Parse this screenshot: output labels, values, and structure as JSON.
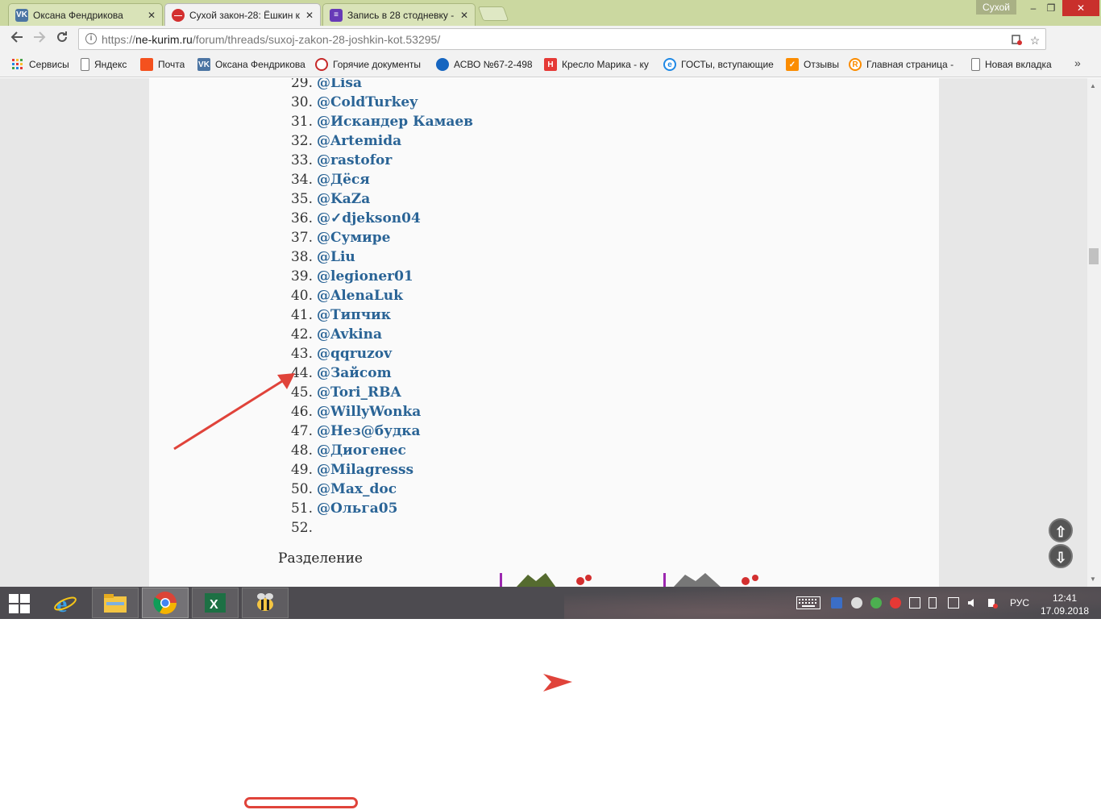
{
  "window": {
    "profile_label": "Сухой",
    "controls": {
      "minimize": "–",
      "restore": "❐",
      "close": "✕"
    }
  },
  "tabs": [
    {
      "label": "Оксана Фендрикова",
      "icon": "vk-icon",
      "icon_text": "VK",
      "icon_color": "#4c75a3",
      "close": "✕"
    },
    {
      "label": "Сухой закон-28: Ёшкин к",
      "icon": "no-entry-icon",
      "icon_text": "—",
      "icon_color": "#d32f2f",
      "close": "✕"
    },
    {
      "label": "Запись в 28 стодневку -",
      "icon": "forms-icon",
      "icon_text": "≡",
      "icon_color": "#673ab7",
      "close": "✕"
    }
  ],
  "toolbar": {
    "url_prefix": "https://",
    "url_host": "ne-kurim.ru",
    "url_path": "/forum/threads/suxoj-zakon-28-joshkin-kot.53295/",
    "extension_badge": "1"
  },
  "bookmarks": [
    {
      "label": "Сервисы",
      "icon": "apps-grid-icon",
      "color": "#e53935"
    },
    {
      "label": "Яндекс",
      "icon": "page-icon",
      "color": "#ffffff"
    },
    {
      "label": "Почта",
      "icon": "mail-icon",
      "color": "#f4511e"
    },
    {
      "label": "Оксана Фендрикова",
      "icon": "vk-icon",
      "color": "#4c75a3"
    },
    {
      "label": "Горячие документы",
      "icon": "globe-icon",
      "color": "#c62828"
    },
    {
      "label": "АСВО №67-2-498",
      "icon": "people-icon",
      "color": "#1565c0"
    },
    {
      "label": "Кресло Марика - ку",
      "icon": "h-icon",
      "color": "#e53935"
    },
    {
      "label": "ГОСТы, вступающие",
      "icon": "e-icon",
      "color": "#1e88e5"
    },
    {
      "label": "Отзывы",
      "icon": "check-icon",
      "color": "#fb8c00"
    },
    {
      "label": "Главная страница - ",
      "icon": "r-icon",
      "color": "#fb8c00"
    },
    {
      "label": "Новая вкладка",
      "icon": "page-icon",
      "color": "#ffffff"
    }
  ],
  "participants": [
    {
      "num": "29.",
      "nick": "@Lisa"
    },
    {
      "num": "30.",
      "nick": "@ColdTurkey"
    },
    {
      "num": "31.",
      "nick": "@Искандер Камаев"
    },
    {
      "num": "32.",
      "nick": "@Artemida"
    },
    {
      "num": "33.",
      "nick": "@rastofor"
    },
    {
      "num": "34.",
      "nick": "@Дёся"
    },
    {
      "num": "35.",
      "nick": "@KaZa"
    },
    {
      "num": "36.",
      "nick": "@✓djekson04"
    },
    {
      "num": "37.",
      "nick": "@Сумире"
    },
    {
      "num": "38.",
      "nick": "@Liu"
    },
    {
      "num": "39.",
      "nick": "@legioner01"
    },
    {
      "num": "40.",
      "nick": "@AlenaLuk"
    },
    {
      "num": "41.",
      "nick": "@Типчик"
    },
    {
      "num": "42.",
      "nick": "@Avkina"
    },
    {
      "num": "43.",
      "nick": "@qqruzov"
    },
    {
      "num": "44.",
      "nick": "@Зайсom"
    },
    {
      "num": "45.",
      "nick": "@Tori_RBA"
    },
    {
      "num": "46.",
      "nick": "@WillyWonka"
    },
    {
      "num": "47.",
      "nick": "@Нез@будка"
    },
    {
      "num": "48.",
      "nick": "@Диогенес"
    },
    {
      "num": "49.",
      "nick": "@Milagresss"
    },
    {
      "num": "50.",
      "nick": "@Max_doc"
    },
    {
      "num": "51.",
      "nick": "@Ольга05"
    },
    {
      "num": "52.",
      "nick": ""
    }
  ],
  "section_label": "Разделение",
  "taskbar": {
    "apps": [
      "internet-explorer-icon",
      "file-explorer-icon",
      "chrome-icon",
      "excel-icon",
      "bee-app-icon"
    ],
    "lang": "РУС",
    "time": "12:41",
    "date": "17.09.2018"
  },
  "annotation_color": "#e0433a"
}
